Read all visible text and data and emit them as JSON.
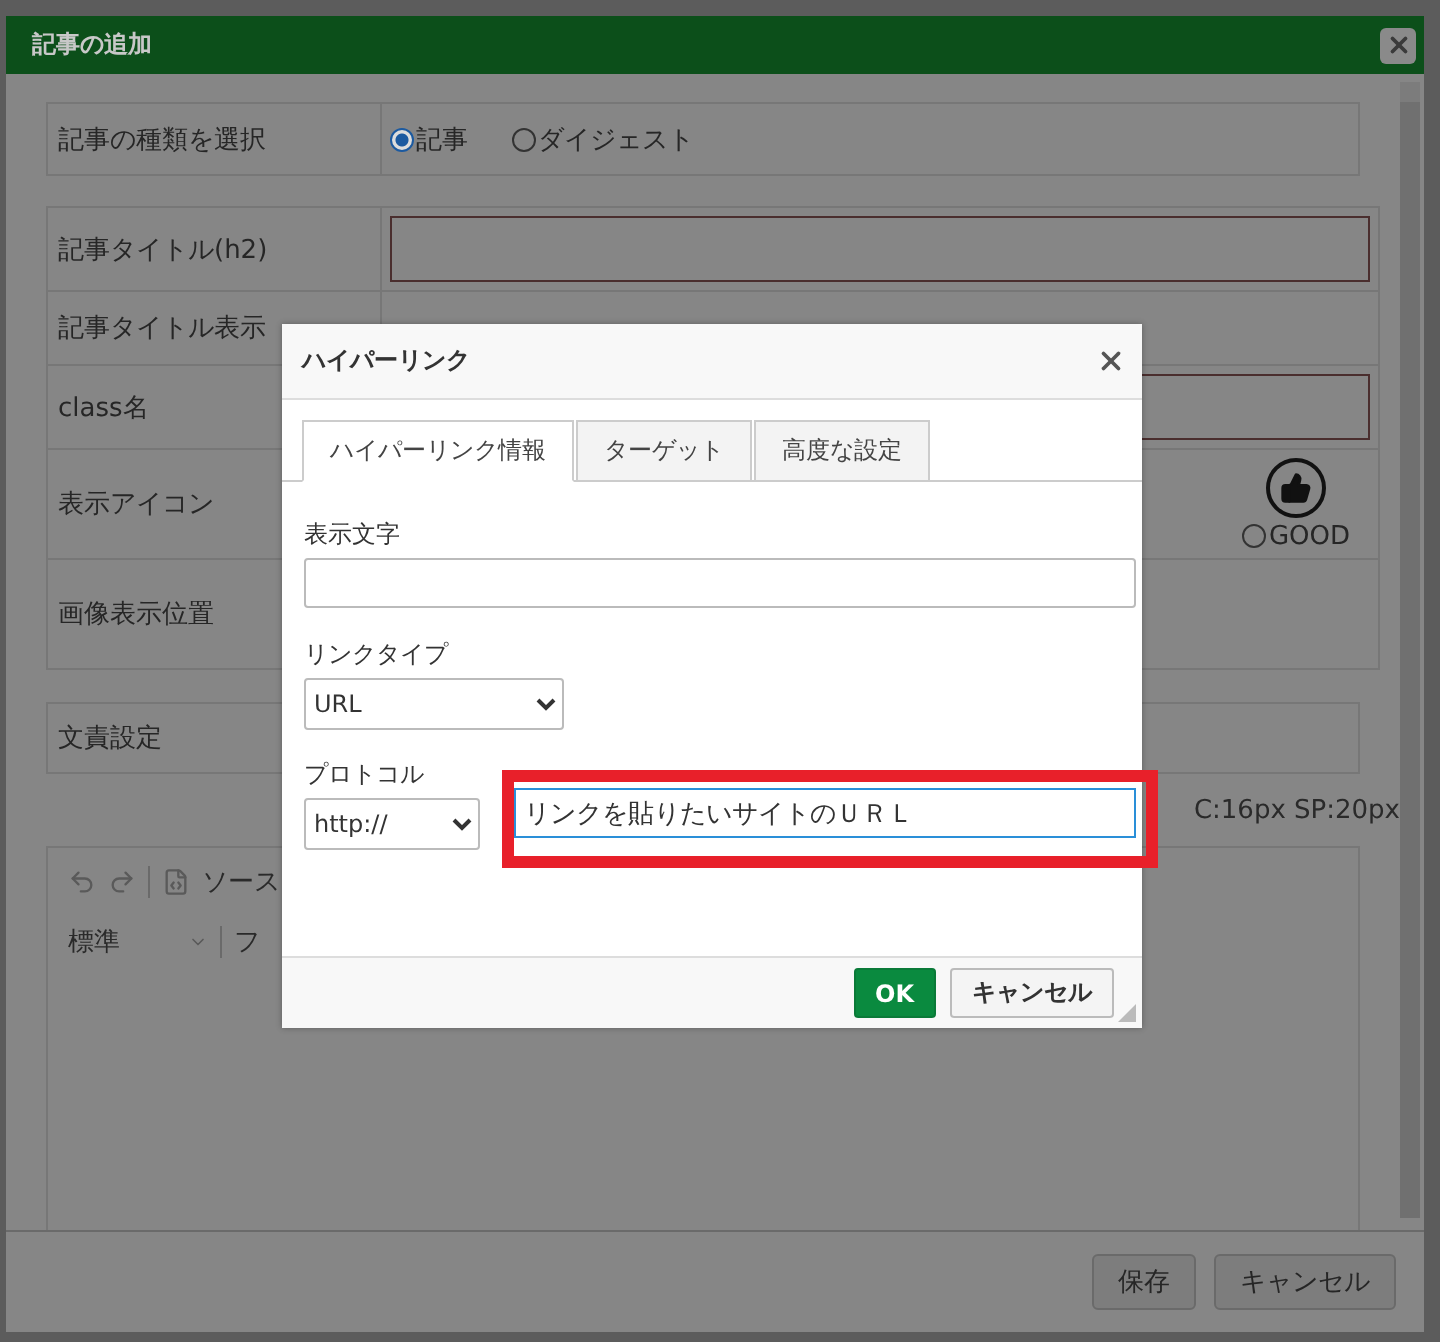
{
  "window": {
    "title": "記事の追加"
  },
  "form": {
    "type_row": {
      "label": "記事の種類を選択",
      "options": [
        {
          "label": "記事",
          "selected": true
        },
        {
          "label": "ダイジェスト",
          "selected": false
        }
      ]
    },
    "rows": [
      {
        "label": "記事タイトル(h2)",
        "kind": "input"
      },
      {
        "label": "記事タイトル表示",
        "kind": "blank"
      },
      {
        "label": "class名",
        "kind": "input"
      },
      {
        "label": "表示アイコン",
        "kind": "icon",
        "option": {
          "label": "GOOD",
          "selected": false
        }
      },
      {
        "label": "画像表示位置",
        "kind": "blank"
      }
    ],
    "byline_row": {
      "label": "文責設定"
    },
    "size_note": "C:16px SP:20px",
    "editor": {
      "source_label": "ソース",
      "format": "標準",
      "font_partial": "フ"
    }
  },
  "footer": {
    "buttons": [
      "保存",
      "キャンセル"
    ]
  },
  "hyperlink_dialog": {
    "title": "ハイパーリンク",
    "tabs": [
      {
        "label": "ハイパーリンク情報",
        "selected": true
      },
      {
        "label": "ターゲット",
        "selected": false
      },
      {
        "label": "高度な設定",
        "selected": false
      }
    ],
    "display_text": {
      "label": "表示文字"
    },
    "link_type": {
      "label": "リンクタイプ",
      "value": "URL"
    },
    "protocol": {
      "label": "プロトコル",
      "value": "http://"
    },
    "url": {
      "value": "リンクを貼りたいサイトのＵＲＬ",
      "highlighted": true
    },
    "buttons": [
      {
        "label": "OK",
        "kind": "primary"
      },
      {
        "label": "キャンセル",
        "kind": "secondary"
      }
    ]
  }
}
